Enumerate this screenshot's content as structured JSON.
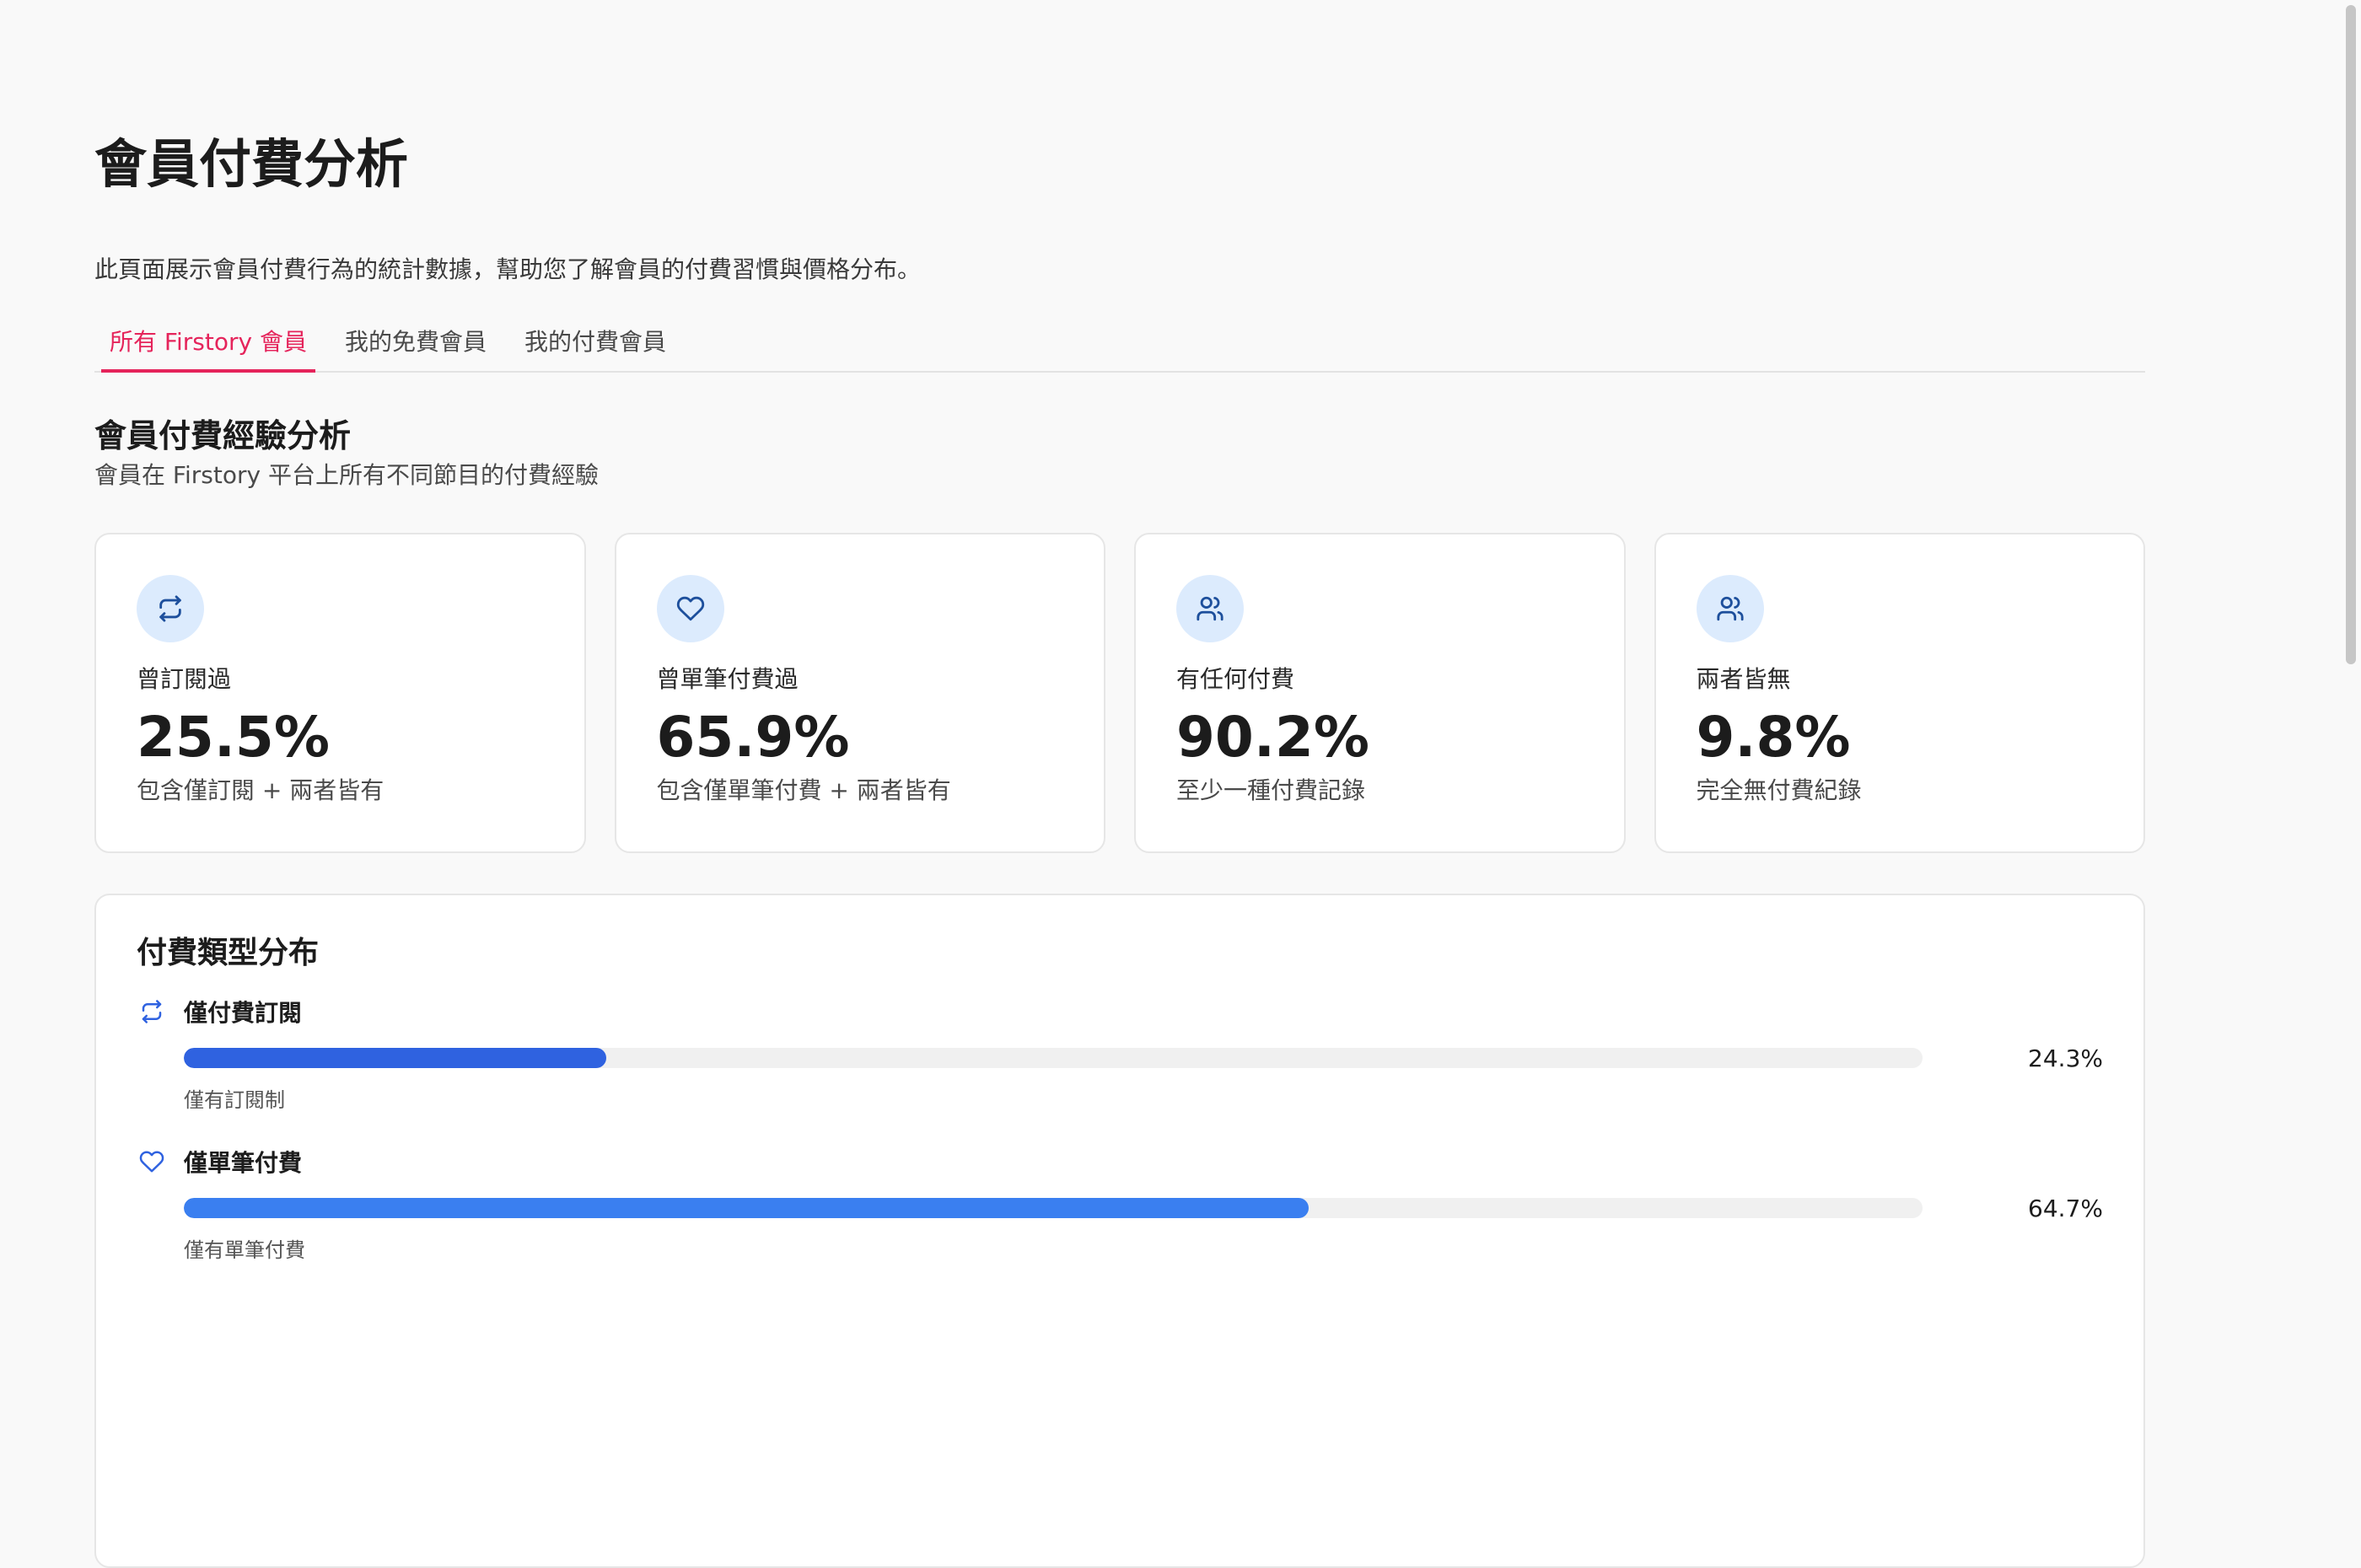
{
  "page": {
    "title": "會員付費分析",
    "description": "此頁面展示會員付費行為的統計數據，幫助您了解會員的付費習慣與價格分布。"
  },
  "tabs": [
    {
      "label": "所有 Firstory 會員",
      "active": true
    },
    {
      "label": "我的免費會員",
      "active": false
    },
    {
      "label": "我的付費會員",
      "active": false
    }
  ],
  "section": {
    "title": "會員付費經驗分析",
    "subtitle": "會員在 Firstory 平台上所有不同節目的付費經驗"
  },
  "cards": [
    {
      "icon": "repeat-icon",
      "label": "曾訂閱過",
      "value": "25.5%",
      "note": "包含僅訂閱 + 兩者皆有"
    },
    {
      "icon": "heart-icon",
      "label": "曾單筆付費過",
      "value": "65.9%",
      "note": "包含僅單筆付費 + 兩者皆有"
    },
    {
      "icon": "users-icon",
      "label": "有任何付費",
      "value": "90.2%",
      "note": "至少一種付費記錄"
    },
    {
      "icon": "users-icon",
      "label": "兩者皆無",
      "value": "9.8%",
      "note": "完全無付費紀錄"
    }
  ],
  "distribution": {
    "title": "付費類型分布",
    "items": [
      {
        "icon": "repeat-icon",
        "label": "僅付費訂閱",
        "percent_text": "24.3%",
        "percent": 24.3,
        "color": "#2f62e0",
        "note": "僅有訂閱制"
      },
      {
        "icon": "heart-icon",
        "label": "僅單筆付費",
        "percent_text": "64.7%",
        "percent": 64.7,
        "color": "#3a7ff0",
        "note": "僅有單筆付費"
      }
    ]
  },
  "colors": {
    "accent": "#e5245b",
    "icon_bg": "#dcebfd",
    "icon_stroke": "#1d4f9c"
  }
}
